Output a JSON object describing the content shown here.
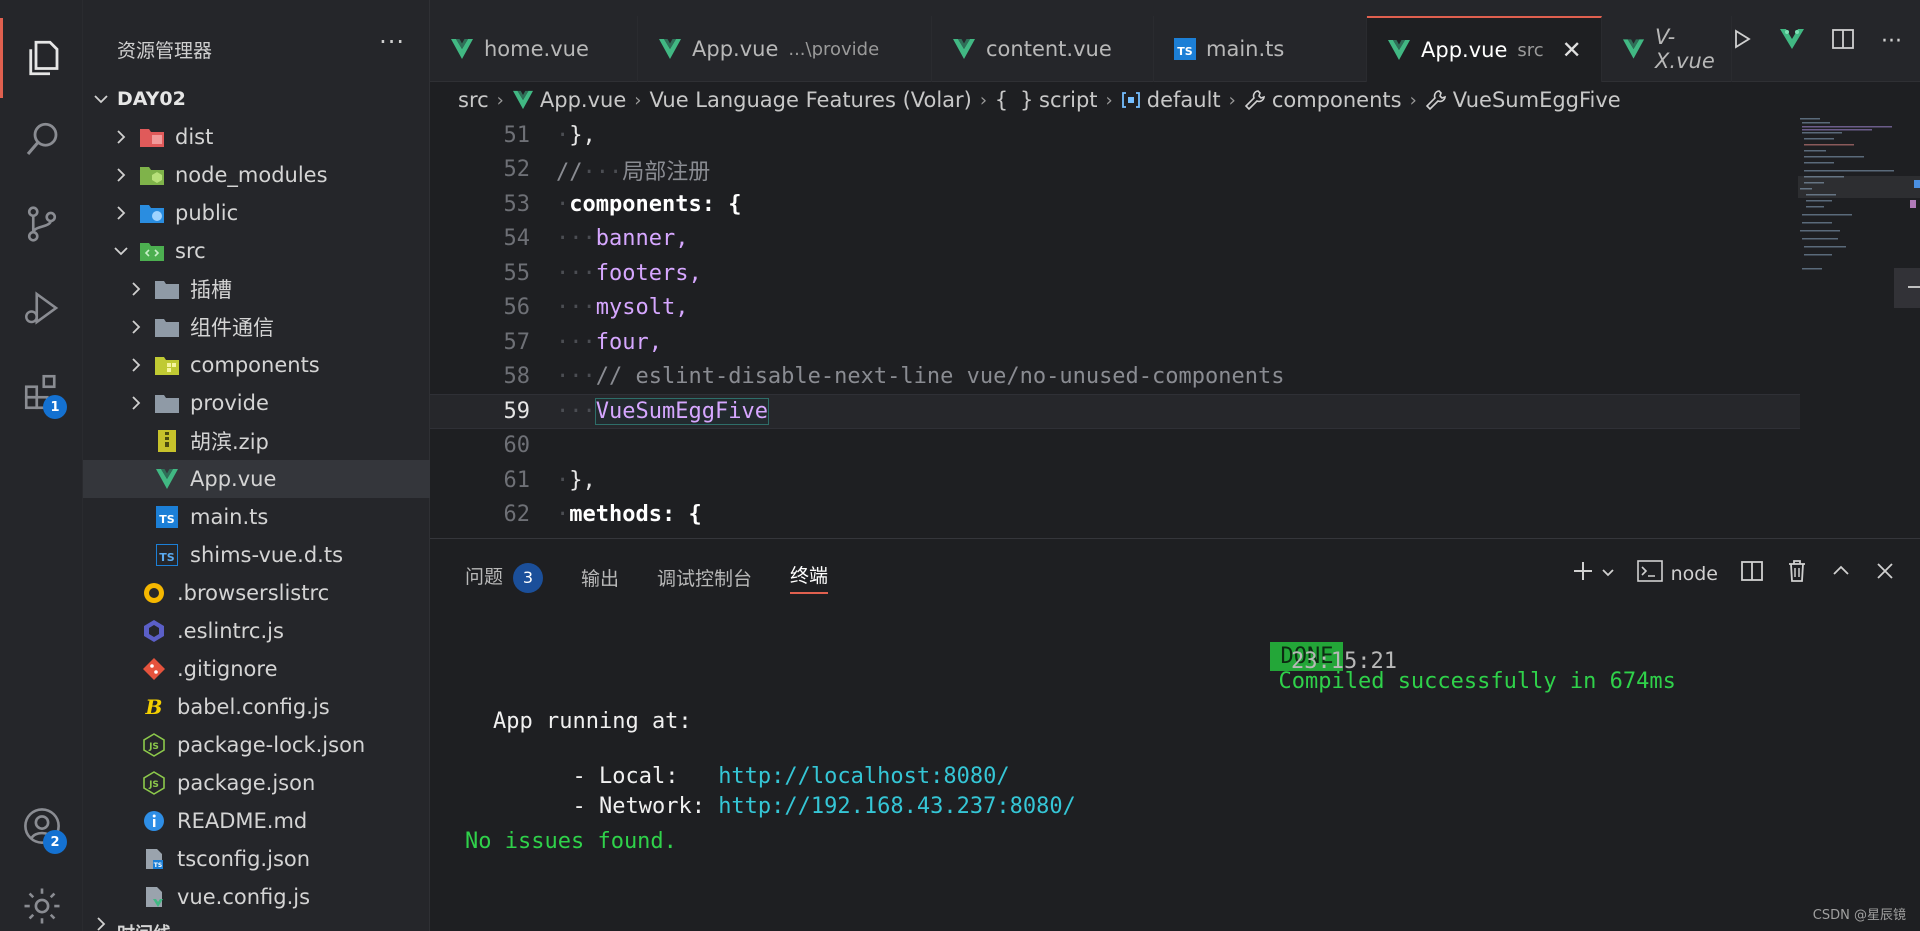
{
  "activity": {
    "extensions_badge": "1",
    "account_badge": "2"
  },
  "sidebar": {
    "title": "资源管理器",
    "more": "···",
    "root": "DAY02",
    "items": [
      {
        "name": "dist"
      },
      {
        "name": "node_modules"
      },
      {
        "name": "public"
      },
      {
        "name": "src"
      },
      {
        "name": "插槽"
      },
      {
        "name": "组件通信"
      },
      {
        "name": "components"
      },
      {
        "name": "provide"
      },
      {
        "name": "胡滨.zip"
      },
      {
        "name": "App.vue"
      },
      {
        "name": "main.ts"
      },
      {
        "name": "shims-vue.d.ts"
      },
      {
        "name": ".browserslistrc"
      },
      {
        "name": ".eslintrc.js"
      },
      {
        "name": ".gitignore"
      },
      {
        "name": "babel.config.js"
      },
      {
        "name": "package-lock.json"
      },
      {
        "name": "package.json"
      },
      {
        "name": "README.md"
      },
      {
        "name": "tsconfig.json"
      },
      {
        "name": "vue.config.js"
      },
      {
        "name": "时间线"
      }
    ]
  },
  "tabs": [
    {
      "label": "home.vue",
      "sub": ""
    },
    {
      "label": "App.vue",
      "sub": "...\\provide"
    },
    {
      "label": "content.vue",
      "sub": ""
    },
    {
      "label": "main.ts",
      "sub": ""
    },
    {
      "label": "App.vue",
      "sub": "src"
    },
    {
      "label": "V-X.vue",
      "sub": ""
    }
  ],
  "breadcrumb": {
    "src": "src",
    "file": "App.vue",
    "lang": "Vue Language Features (Volar)",
    "script": "script",
    "default": "default",
    "components": "components",
    "symbol": "VueSumEggFive"
  },
  "editor": {
    "lines": [
      {
        "n": "51",
        "text": "},"
      },
      {
        "n": "52",
        "text": "局部注册"
      },
      {
        "n": "53",
        "text": "components: {"
      },
      {
        "n": "54",
        "text": "banner,"
      },
      {
        "n": "55",
        "text": "footers,"
      },
      {
        "n": "56",
        "text": "mysolt,"
      },
      {
        "n": "57",
        "text": "four,"
      },
      {
        "n": "58",
        "text": "// eslint-disable-next-line vue/no-unused-components"
      },
      {
        "n": "59",
        "text": "VueSumEggFive"
      },
      {
        "n": "60",
        "text": ""
      },
      {
        "n": "61",
        "text": "},"
      },
      {
        "n": "62",
        "text": "methods: {"
      }
    ]
  },
  "panel": {
    "tabs": {
      "problems": "问题",
      "problems_count": "3",
      "output": "输出",
      "debug": "调试控制台",
      "terminal": "终端"
    },
    "node": "node",
    "terminal": {
      "done": "DONE",
      "compiled": "Compiled successfully in 674ms",
      "time": "23:15:21",
      "running": "App running at:",
      "local_label": "- Local:   ",
      "local_url": "http://localhost:8080/",
      "network_label": "- Network: ",
      "network_url": "http://192.168.43.237:8080/",
      "no_issues": "No issues found."
    }
  },
  "watermark": "CSDN @星辰镜"
}
